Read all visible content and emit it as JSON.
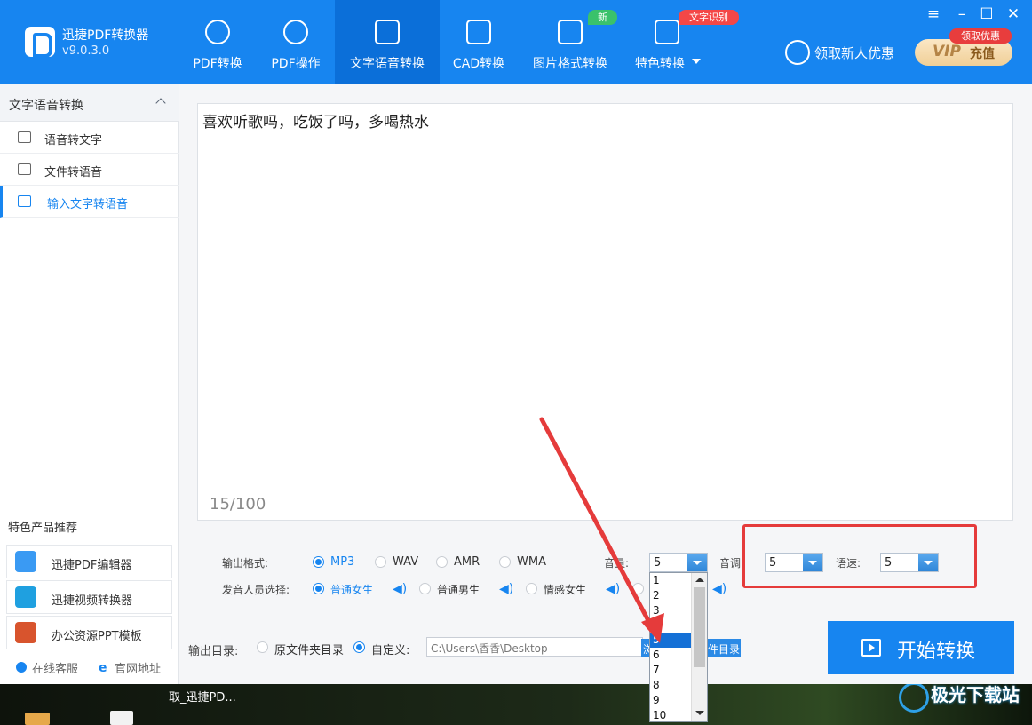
{
  "app": {
    "name": "迅捷PDF转换器",
    "version": "v9.0.3.0"
  },
  "nav": {
    "tabs": [
      {
        "label": "PDF转换",
        "icon": "pdf-convert-icon"
      },
      {
        "label": "PDF操作",
        "icon": "pdf-gear-icon"
      },
      {
        "label": "文字语音转换",
        "icon": "waveform-icon",
        "active": true
      },
      {
        "label": "CAD转换",
        "icon": "cad-icon"
      },
      {
        "label": "图片格式转换",
        "icon": "image-icon",
        "badge": "新"
      },
      {
        "label": "特色转换",
        "icon": "star-icon",
        "badge": "文字识别"
      }
    ],
    "user_label": "领取新人优惠",
    "vip_badge": "领取优惠",
    "vip_word": "VIP",
    "vip_charge": "充值",
    "accent_color": "#1785f0"
  },
  "window": {
    "menu": "≡",
    "minimize": "–",
    "maximize": "☐",
    "close": "✕"
  },
  "sidebar": {
    "section_title": "文字语音转换",
    "items": [
      {
        "label": "语音转文字",
        "icon": "waveform-icon"
      },
      {
        "label": "文件转语音",
        "icon": "file-icon"
      },
      {
        "label": "输入文字转语音",
        "icon": "text-box-icon",
        "active": true
      }
    ],
    "promo_title": "特色产品推荐",
    "promo_items": [
      {
        "label": "迅捷PDF编辑器",
        "icon": "pdf-editor-icon"
      },
      {
        "label": "迅捷视频转换器",
        "icon": "video-converter-icon"
      },
      {
        "label": "办公资源PPT模板",
        "icon": "ppt-icon"
      }
    ],
    "footer": {
      "service": "在线客服",
      "website": "官网地址"
    }
  },
  "editor": {
    "text": "喜欢听歌吗，吃饭了吗，多喝热水",
    "count": "15/100"
  },
  "options": {
    "format_label": "输出格式:",
    "formats": [
      "MP3",
      "WAV",
      "AMR",
      "WMA"
    ],
    "selected_format": "MP3",
    "volume_label": "音量:",
    "volume_value": "5",
    "pitch_label": "音调:",
    "pitch_value": "5",
    "speed_label": "语速:",
    "speed_value": "5",
    "speaker_label": "发音人员选择:",
    "speakers": [
      "普通女生",
      "普通男生",
      "情感女生"
    ],
    "selected_speaker": "普通女生",
    "volume_options": [
      "1",
      "2",
      "3",
      "4",
      "5",
      "6",
      "7",
      "8",
      "9",
      "10"
    ],
    "highlighted_option": "5"
  },
  "output": {
    "dir_label": "输出目录:",
    "opt_original": "原文件夹目录",
    "opt_custom": "自定义:",
    "path": "C:\\Users\\香香\\Desktop",
    "browse_partial": "浏",
    "open_dir_partial": "件目录",
    "start_button": "开始转换"
  },
  "desktop": {
    "taskbar_label": "取_迅捷PD...",
    "watermark": "极光下载站"
  }
}
